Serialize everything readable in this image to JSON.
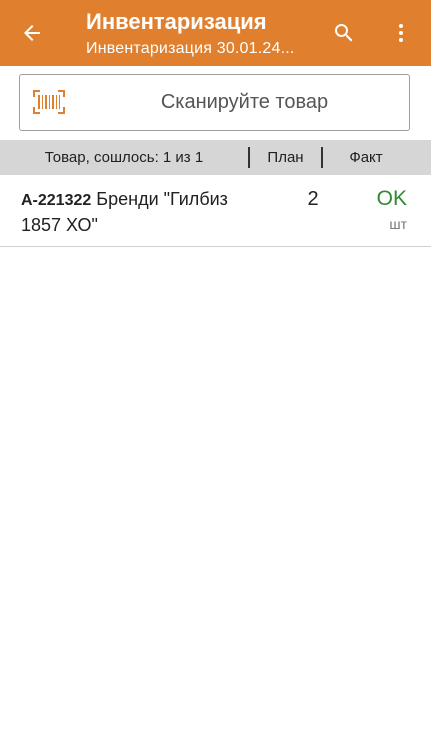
{
  "appbar": {
    "title": "Инвентаризация",
    "subtitle": "Инвентаризация 30.01.24...",
    "background": "#e0802f",
    "icons": {
      "back": "arrow-left-icon",
      "search": "search-icon",
      "menu": "more-vertical-icon"
    }
  },
  "scan": {
    "placeholder": "Сканируйте товар",
    "icon": "barcode-scan-icon",
    "icon_color": "#e0802f"
  },
  "table": {
    "headers": {
      "product": "Товар, сошлось: 1 из 1",
      "plan": "План",
      "fact": "Факт"
    },
    "rows": [
      {
        "code": "А-221322",
        "name": "Бренди \"Гилбиз 1857 ХО\"",
        "plan": "2",
        "fact": "OK",
        "unit": "шт",
        "fact_color": "#2e8b2e"
      }
    ]
  }
}
